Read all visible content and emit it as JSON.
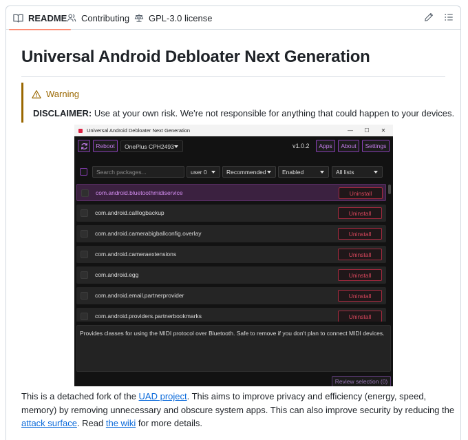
{
  "tabs": {
    "readme": "README",
    "contributing": "Contributing",
    "license": "GPL-3.0 license"
  },
  "title": "Universal Android Debloater Next Generation",
  "warning": {
    "title": "Warning",
    "label": "DISCLAIMER:",
    "text": " Use at your own risk. We're not responsible for anything that could happen to your devices."
  },
  "app": {
    "window_title": "Universal Android Debloater Next Generation",
    "reboot": "Reboot",
    "device": "OnePlus CPH2493",
    "version": "v1.0.2",
    "apps": "Apps",
    "about": "About",
    "settings": "Settings",
    "search_placeholder": "Search packages...",
    "user": "user 0",
    "recommendation": "Recommended",
    "state": "Enabled",
    "list": "All lists",
    "uninstall_label": "Uninstall",
    "packages": [
      "com.android.bluetoothmidiservice",
      "com.android.calllogbackup",
      "com.android.camerabigballconfig.overlay",
      "com.android.cameraextensions",
      "com.android.egg",
      "com.android.email.partnerprovider",
      "com.android.providers.partnerbookmarks"
    ],
    "description": "Provides classes for using the MIDI protocol over Bluetooth. Safe to remove if you don't plan to connect MIDI devices.",
    "review": "Review selection (0)"
  },
  "intro": {
    "t1": "This is a detached fork of the ",
    "link1": "UAD project",
    "t2": ". This aims to improve privacy and efficiency (energy, speed, memory) by removing unnecessary and obscure system apps. This can also improve security by reducing the ",
    "link2": "attack surface",
    "t3": ". Read ",
    "link3": "the wiki",
    "t4": " for more details."
  },
  "colors": {
    "accent_underline": "#fd8c73",
    "warning": "#9a6700",
    "link": "#0969da",
    "app_purple": "#8a3fb8",
    "app_red": "#d9475d"
  }
}
